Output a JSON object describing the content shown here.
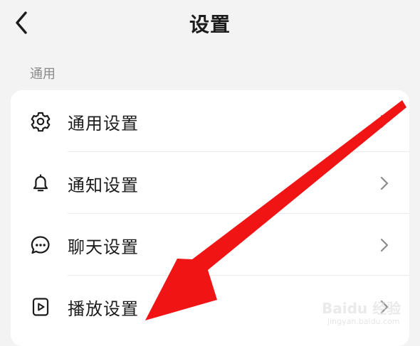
{
  "header": {
    "title": "设置",
    "back_icon": "chevron-left-icon"
  },
  "section": {
    "label": "通用"
  },
  "items": [
    {
      "label": "通用设置",
      "icon": "gear-icon"
    },
    {
      "label": "通知设置",
      "icon": "bell-icon"
    },
    {
      "label": "聊天设置",
      "icon": "chat-bubble-icon"
    },
    {
      "label": "播放设置",
      "icon": "play-box-icon"
    }
  ],
  "annotation": {
    "color": "#f01414"
  },
  "watermark": {
    "brand": "Baidu 经验",
    "sub": "jingyan.baidu.com"
  }
}
